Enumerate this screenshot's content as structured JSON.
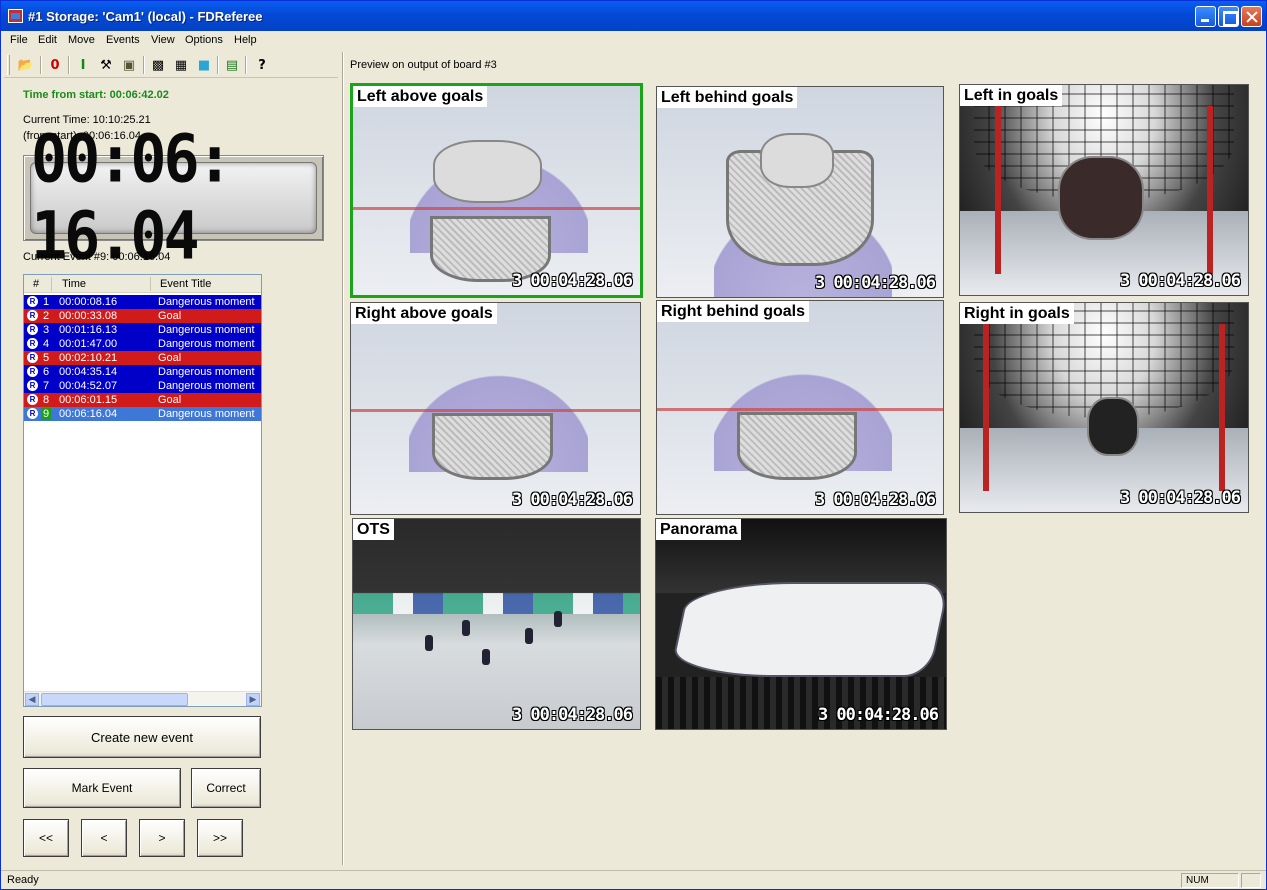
{
  "window": {
    "title": "#1 Storage: 'Cam1' (local) -  FDReferee"
  },
  "menu": [
    "File",
    "Edit",
    "Move",
    "Events",
    "View",
    "Options",
    "Help"
  ],
  "toolbar": {
    "icons": [
      "open-folder-icon",
      "record-zero-icon",
      "text-cursor-icon",
      "tools-icon",
      "monitor-icon",
      "camera-icon",
      "film-icon",
      "display-icon",
      "list-icon",
      "help-icon"
    ]
  },
  "left": {
    "time_from_start": "Time from start: 00:06:42.02",
    "current_time": "Current Time: 10:10:25.21",
    "from_start": "(from start): 00:06:16.04",
    "lcd": "00:06: 16.04",
    "current_event": "Current Event #9: 00:06:16.04"
  },
  "event_list": {
    "headers": {
      "num": "#",
      "time": "Time",
      "title": "Event Title"
    },
    "rows": [
      {
        "icon": "R",
        "num": "1",
        "time": "00:00:08.16",
        "title": "Dangerous moment"
      },
      {
        "icon": "R",
        "num": "2",
        "time": "00:00:33.08",
        "title": "Goal"
      },
      {
        "icon": "R",
        "num": "3",
        "time": "00:01:16.13",
        "title": "Dangerous moment"
      },
      {
        "icon": "R",
        "num": "4",
        "time": "00:01:47.00",
        "title": "Dangerous moment"
      },
      {
        "icon": "R",
        "num": "5",
        "time": "00:02:10.21",
        "title": "Goal"
      },
      {
        "icon": "R",
        "num": "6",
        "time": "00:04:35.14",
        "title": "Dangerous moment"
      },
      {
        "icon": "R",
        "num": "7",
        "time": "00:04:52.07",
        "title": "Dangerous moment"
      },
      {
        "icon": "R",
        "num": "8",
        "time": "00:06:01.15",
        "title": "Goal"
      },
      {
        "icon": "R",
        "num": "9",
        "time": "00:06:16.04",
        "title": "Dangerous moment"
      }
    ],
    "colors": {
      "dangerous": "#0000c8",
      "goal": "#d11a1a",
      "selected": "#3d78d8"
    }
  },
  "buttons": {
    "create": "Create new event",
    "mark": "Mark Event",
    "correct": "Correct",
    "first": "<<",
    "prev": "<",
    "next": ">",
    "last": ">>"
  },
  "preview": {
    "title": "Preview on output of board #3",
    "cameras": [
      {
        "label": "Left above goals",
        "stamp": "3 00:04:28.06"
      },
      {
        "label": "Left behind goals",
        "stamp": "3 00:04:28.06"
      },
      {
        "label": "Left in goals",
        "stamp": "3 00:04:28.06"
      },
      {
        "label": "Right above goals",
        "stamp": "3 00:04:28.06"
      },
      {
        "label": "Right behind goals",
        "stamp": "3 00:04:28.06"
      },
      {
        "label": "Right in goals",
        "stamp": "3 00:04:28.06"
      },
      {
        "label": "OTS",
        "stamp": "3 00:04:28.06"
      },
      {
        "label": "Panorama",
        "stamp": "3 00:04:28.06"
      }
    ],
    "active_color": "#19a51a"
  },
  "status": {
    "text": "Ready",
    "num": "NUM"
  }
}
